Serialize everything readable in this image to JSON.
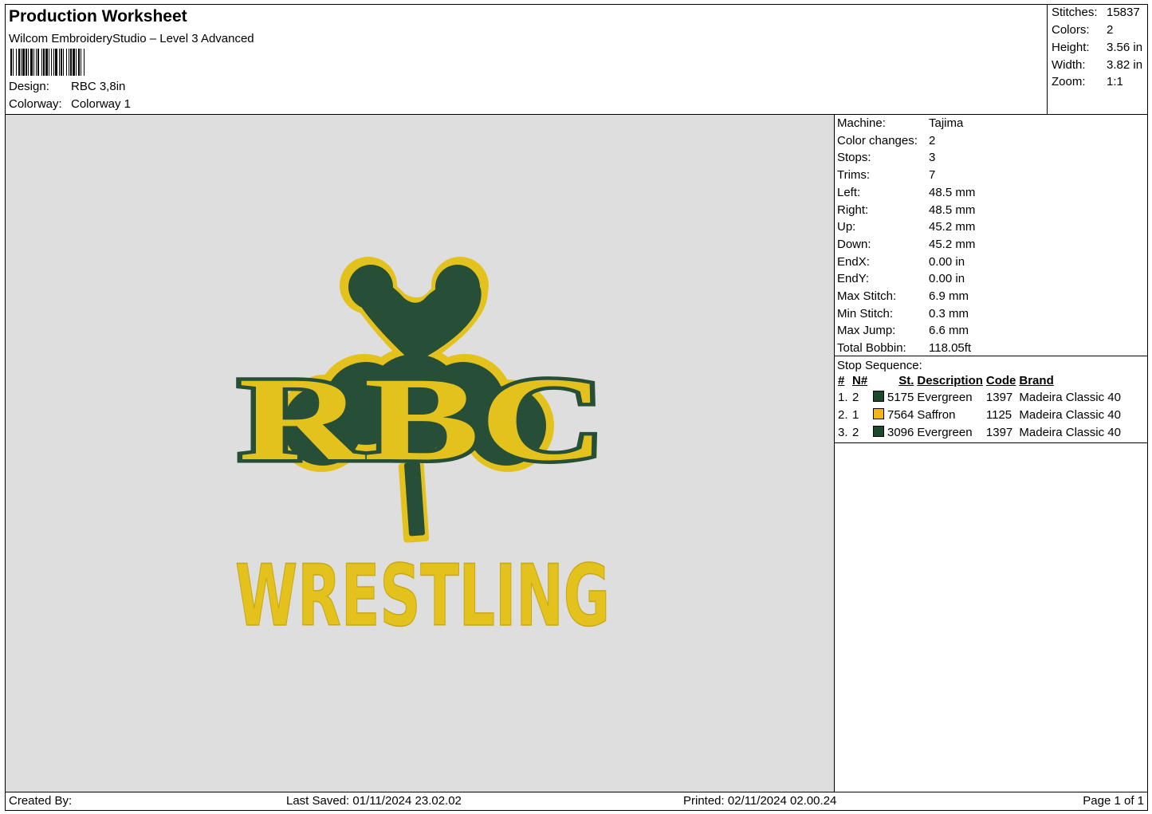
{
  "header": {
    "title": "Production Worksheet",
    "software": "Wilcom EmbroideryStudio – Level 3 Advanced",
    "design_label": "Design:",
    "design_value": "RBC 3,8in",
    "colorway_label": "Colorway:",
    "colorway_value": "Colorway 1"
  },
  "stats": {
    "stitches_label": "Stitches:",
    "stitches_value": "15837",
    "colors_label": "Colors:",
    "colors_value": "2",
    "height_label": "Height:",
    "height_value": "3.56 in",
    "width_label": "Width:",
    "width_value": "3.82 in",
    "zoom_label": "Zoom:",
    "zoom_value": "1:1"
  },
  "machine_info": [
    {
      "label": "Machine:",
      "value": "Tajima"
    },
    {
      "label": "Color changes:",
      "value": "2"
    },
    {
      "label": "Stops:",
      "value": "3"
    },
    {
      "label": "Trims:",
      "value": "7"
    },
    {
      "label": "Left:",
      "value": "48.5 mm"
    },
    {
      "label": "Right:",
      "value": "48.5 mm"
    },
    {
      "label": "Up:",
      "value": "45.2 mm"
    },
    {
      "label": "Down:",
      "value": "45.2 mm"
    },
    {
      "label": "EndX:",
      "value": "0.00 in"
    },
    {
      "label": "EndY:",
      "value": "0.00 in"
    },
    {
      "label": "Max Stitch:",
      "value": "6.9 mm"
    },
    {
      "label": "Min Stitch:",
      "value": "0.3 mm"
    },
    {
      "label": "Max Jump:",
      "value": "6.6 mm"
    },
    {
      "label": "Total Bobbin:",
      "value": "118.05ft"
    }
  ],
  "stop_sequence": {
    "title": "Stop Sequence:",
    "columns": [
      "#",
      "N#",
      "St.",
      "Description",
      "Code",
      "Brand"
    ],
    "rows": [
      {
        "num": "1.",
        "n": "2",
        "color": "#1b4a2a",
        "st": "5175",
        "description": "Evergreen",
        "code": "1397",
        "brand": "Madeira Classic 40"
      },
      {
        "num": "2.",
        "n": "1",
        "color": "#f2b41c",
        "st": "7564",
        "description": "Saffron",
        "code": "1125",
        "brand": "Madeira Classic 40"
      },
      {
        "num": "3.",
        "n": "2",
        "color": "#1b4a2a",
        "st": "3096",
        "description": "Evergreen",
        "code": "1397",
        "brand": "Madeira Classic 40"
      }
    ]
  },
  "design": {
    "monogram": "RBC",
    "lettering": "WRESTLING",
    "colors": {
      "evergreen": "#274f37",
      "saffron": "#e4c21e",
      "background": "#dedede"
    }
  },
  "footer": {
    "created_by": "Created By:",
    "last_saved": "Last Saved: 01/11/2024 23.02.02",
    "printed": "Printed: 02/11/2024 02.00.24",
    "page": "Page 1 of 1"
  }
}
